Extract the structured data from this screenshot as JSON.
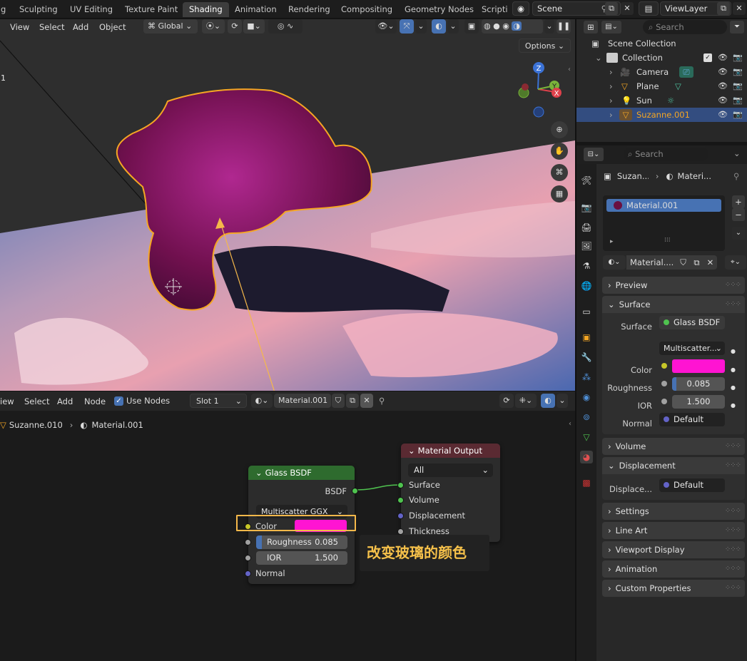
{
  "workspace_tabs": [
    "g",
    "Sculpting",
    "UV Editing",
    "Texture Paint",
    "Shading",
    "Animation",
    "Rendering",
    "Compositing",
    "Geometry Nodes",
    "Scripti"
  ],
  "active_tab": "Shading",
  "scene_name": "Scene",
  "view_layer": "ViewLayer",
  "viewport": {
    "menus": [
      "View",
      "Select",
      "Add",
      "Object"
    ],
    "transform_orientation": "Global",
    "options_label": "Options",
    "edge_text": "1",
    "gizmo_axes": {
      "z": "Z",
      "y": "Y",
      "x": "X"
    }
  },
  "outliner": {
    "search_placeholder": "Search",
    "scene_collection": "Scene Collection",
    "collection": "Collection",
    "items": [
      "Camera",
      "Plane",
      "Sun",
      "Suzanne.001"
    ],
    "selected": "Suzanne.001"
  },
  "node_editor": {
    "menus": [
      "iew",
      "Select",
      "Add",
      "Node"
    ],
    "use_nodes_label": "Use Nodes",
    "slot": "Slot 1",
    "material": "Material.001",
    "breadcrumb": [
      "Suzanne.010",
      "Material.001"
    ],
    "glass_node": {
      "title": "Glass BSDF",
      "output": "BSDF",
      "distribution": "Multiscatter GGX",
      "color_label": "Color",
      "color": "#ff14d2",
      "roughness_label": "Roughness",
      "roughness": "0.085",
      "ior_label": "IOR",
      "ior": "1.500",
      "normal_label": "Normal"
    },
    "output_node": {
      "title": "Material Output",
      "target": "All",
      "inputs": [
        "Surface",
        "Volume",
        "Displacement",
        "Thickness"
      ]
    },
    "annotation": "改变玻璃的颜色"
  },
  "properties": {
    "search_placeholder": "Search",
    "breadcrumb": [
      "Suzan...",
      "Materi..."
    ],
    "material_slot": "Material.001",
    "material_field": "Material....",
    "panels": {
      "preview": "Preview",
      "surface": "Surface",
      "volume": "Volume",
      "displacement": "Displacement",
      "settings": "Settings",
      "line_art": "Line Art",
      "viewport_display": "Viewport Display",
      "animation": "Animation",
      "custom_properties": "Custom Properties"
    },
    "surface_label": "Surface",
    "surface_shader": "Glass BSDF",
    "distribution": "Multiscatter...",
    "color_label": "Color",
    "color": "#ff14d2",
    "roughness_label": "Roughness",
    "roughness": "0.085",
    "ior_label": "IOR",
    "ior": "1.500",
    "normal_label": "Normal",
    "normal_value": "Default",
    "displacement_label": "Displace...",
    "displacement_value": "Default"
  },
  "colors": {
    "accent": "#4772b3",
    "selection_orange": "#f5a623",
    "glass_header": "#2e6b2e",
    "output_header": "#5a2a32",
    "socket_yellow": "#c7c729",
    "socket_green": "#4fc34f",
    "socket_grey": "#a1a1a1",
    "socket_purple": "#6363c7"
  }
}
